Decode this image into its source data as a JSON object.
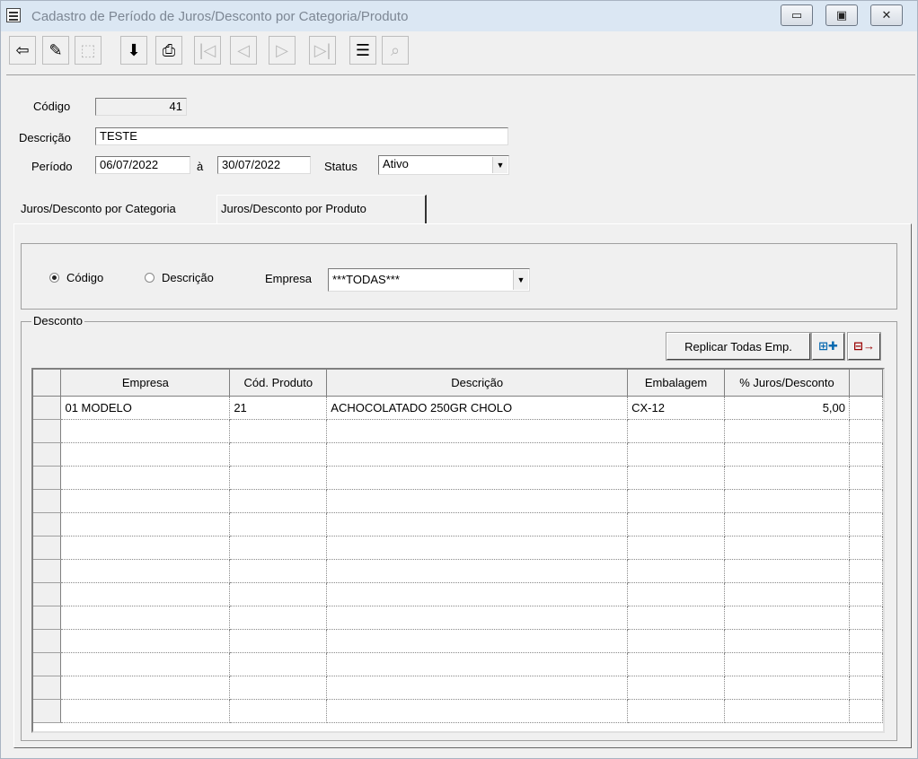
{
  "window": {
    "title": "Cadastro de Período de Juros/Desconto por Categoria/Produto",
    "controls": {
      "minimize": "▭",
      "maximize": "▣",
      "close": "✕"
    }
  },
  "toolbar": {
    "buttons": [
      {
        "name": "exit",
        "icon": "exit-door-icon",
        "glyph": "⇦",
        "enabled": true
      },
      {
        "name": "edit",
        "icon": "pencil-icon",
        "glyph": "✎",
        "enabled": true
      },
      {
        "name": "new",
        "icon": "new-record-icon",
        "glyph": "⬚",
        "enabled": false
      },
      {
        "name": "save",
        "icon": "save-icon",
        "glyph": "⬇",
        "enabled": true
      },
      {
        "name": "print",
        "icon": "printer-icon",
        "glyph": "⎙",
        "enabled": true
      },
      {
        "name": "first",
        "icon": "first-record-icon",
        "glyph": "|◁",
        "enabled": false
      },
      {
        "name": "prev",
        "icon": "prev-record-icon",
        "glyph": "◁",
        "enabled": false
      },
      {
        "name": "next",
        "icon": "next-record-icon",
        "glyph": "▷",
        "enabled": false
      },
      {
        "name": "last",
        "icon": "last-record-icon",
        "glyph": "▷|",
        "enabled": false
      },
      {
        "name": "list",
        "icon": "list-icon",
        "glyph": "☰",
        "enabled": true
      },
      {
        "name": "search",
        "icon": "search-record-icon",
        "glyph": "⌕",
        "enabled": false
      }
    ]
  },
  "form": {
    "codigo_label": "Código",
    "codigo_value": "41",
    "descricao_label": "Descrição",
    "descricao_value": "TESTE",
    "periodo_label": "Período",
    "periodo_inicio": "06/07/2022",
    "periodo_sep": "à",
    "periodo_fim": "30/07/2022",
    "status_label": "Status",
    "status_value": "Ativo"
  },
  "tabs": [
    {
      "label": "Juros/Desconto por Categoria",
      "active": false
    },
    {
      "label": "Juros/Desconto por Produto",
      "active": true
    }
  ],
  "filter": {
    "radio_codigo": "Código",
    "radio_descricao": "Descrição",
    "selected": "codigo",
    "empresa_label": "Empresa",
    "empresa_value": "***TODAS***"
  },
  "desconto": {
    "legend": "Desconto",
    "replicar_label": "Replicar Todas Emp.",
    "add_icon": "add-row-icon",
    "remove_icon": "remove-row-icon"
  },
  "grid": {
    "columns": [
      "Empresa",
      "Cód. Produto",
      "Descrição",
      "Embalagem",
      "% Juros/Desconto"
    ],
    "rows": [
      [
        "01 MODELO",
        "21",
        "ACHOCOLATADO 250GR CHOLO",
        "CX-12",
        "5,00"
      ]
    ],
    "empty_rows": 13
  }
}
